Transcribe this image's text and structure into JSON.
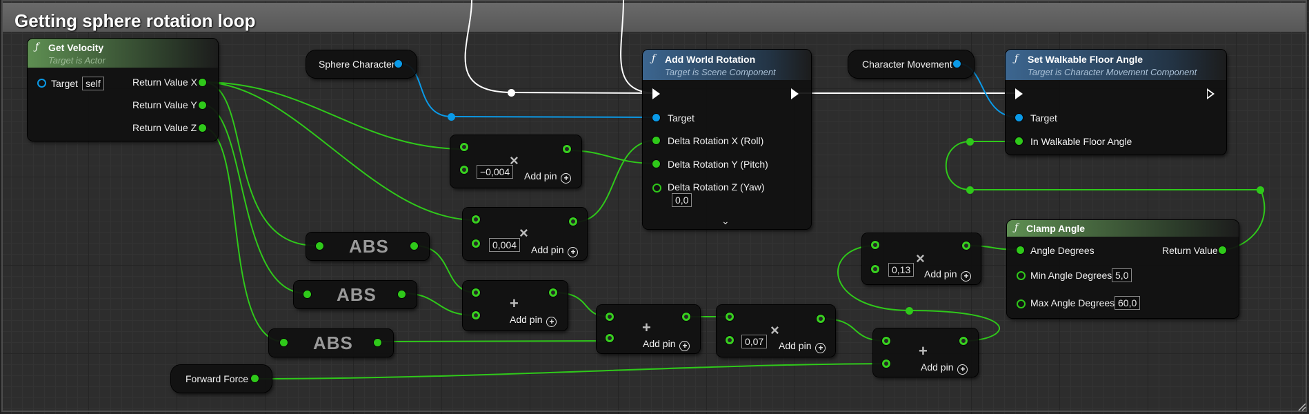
{
  "comment": {
    "title": "Getting sphere rotation loop"
  },
  "colors": {
    "float_pin": "#2fc91a",
    "object_pin": "#0a9ae8",
    "exec_pin": "#ffffff",
    "pure_header": "#5e8f52",
    "impure_header": "#3c6690"
  },
  "icons": {
    "function": "function-f-icon",
    "add_pin": "plus-circle-icon",
    "expand": "chevron-down-icon"
  },
  "get_velocity": {
    "title": "Get Velocity",
    "subtitle": "Target is Actor",
    "target_label": "Target",
    "target_value": "self",
    "outputs": [
      "Return Value X",
      "Return Value Y",
      "Return Value Z"
    ]
  },
  "sphere_character": {
    "label": "Sphere Character"
  },
  "character_movement": {
    "label": "Character Movement"
  },
  "forward_force": {
    "label": "Forward Force"
  },
  "add_world_rotation": {
    "title": "Add World Rotation",
    "subtitle": "Target is Scene Component",
    "pins": [
      "Target",
      "Delta Rotation X (Roll)",
      "Delta Rotation Y (Pitch)",
      "Delta Rotation Z (Yaw)"
    ],
    "yaw_value": "0,0"
  },
  "set_walkable": {
    "title": "Set Walkable Floor Angle",
    "subtitle": "Target is Character Movement Component",
    "pins": [
      "Target",
      "In Walkable Floor Angle"
    ]
  },
  "clamp_angle": {
    "title": "Clamp Angle",
    "pins": [
      "Angle Degrees",
      "Min Angle Degrees",
      "Max Angle Degrees"
    ],
    "output": "Return Value",
    "min_value": "5,0",
    "max_value": "60,0"
  },
  "abs_nodes": [
    "ABS",
    "ABS",
    "ABS"
  ],
  "math_nodes": {
    "mul_roll": {
      "op": "×",
      "value": "−0,004",
      "add_pin": "Add pin"
    },
    "mul_pitch": {
      "op": "×",
      "value": "0,004",
      "add_pin": "Add pin"
    },
    "add_abs": {
      "op": "+",
      "add_pin": "Add pin"
    },
    "add_abs2": {
      "op": "+",
      "add_pin": "Add pin"
    },
    "mul_007": {
      "op": "×",
      "value": "0,07",
      "add_pin": "Add pin"
    },
    "mul_013": {
      "op": "×",
      "value": "0,13",
      "add_pin": "Add pin"
    },
    "add_force": {
      "op": "+",
      "add_pin": "Add pin"
    }
  }
}
